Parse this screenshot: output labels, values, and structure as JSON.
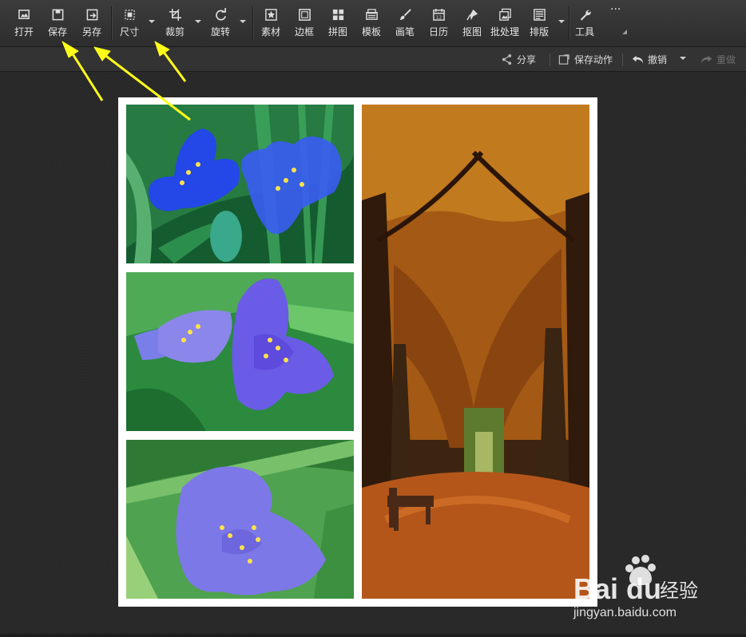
{
  "toolbar": {
    "items": [
      {
        "label": "打开",
        "icon": "open-image-icon"
      },
      {
        "label": "保存",
        "icon": "save-icon"
      },
      {
        "label": "另存",
        "icon": "save-as-icon"
      },
      {
        "label": "尺寸",
        "icon": "resize-icon"
      },
      {
        "label": "裁剪",
        "icon": "crop-icon"
      },
      {
        "label": "旋转",
        "icon": "rotate-icon"
      },
      {
        "label": "素材",
        "icon": "material-icon"
      },
      {
        "label": "边框",
        "icon": "border-icon"
      },
      {
        "label": "拼图",
        "icon": "collage-icon"
      },
      {
        "label": "模板",
        "icon": "template-icon"
      },
      {
        "label": "画笔",
        "icon": "brush-icon"
      },
      {
        "label": "日历",
        "icon": "calendar-icon"
      },
      {
        "label": "抠图",
        "icon": "cutout-icon"
      },
      {
        "label": "批处理",
        "icon": "batch-icon"
      },
      {
        "label": "排版",
        "icon": "layout-icon"
      },
      {
        "label": "工具",
        "icon": "tools-icon"
      }
    ],
    "more": "···"
  },
  "subbar": {
    "share": "分享",
    "save_action": "保存动作",
    "undo": "撤销",
    "redo": "重做"
  },
  "collage": {
    "photos": [
      "blue flowers",
      "purple flowers",
      "violet flower",
      "autumn tree avenue"
    ]
  },
  "watermark": {
    "brand": "Bai du",
    "cn": "经验",
    "url": "jingyan.baidu.com"
  },
  "annotation": {
    "arrow_color": "#ffff1a",
    "targets": [
      "保存",
      "另存",
      "尺寸"
    ]
  },
  "colors": {
    "toolbar_bg": "#333333",
    "canvas_bg": "#262626",
    "frame": "#ffffff"
  }
}
